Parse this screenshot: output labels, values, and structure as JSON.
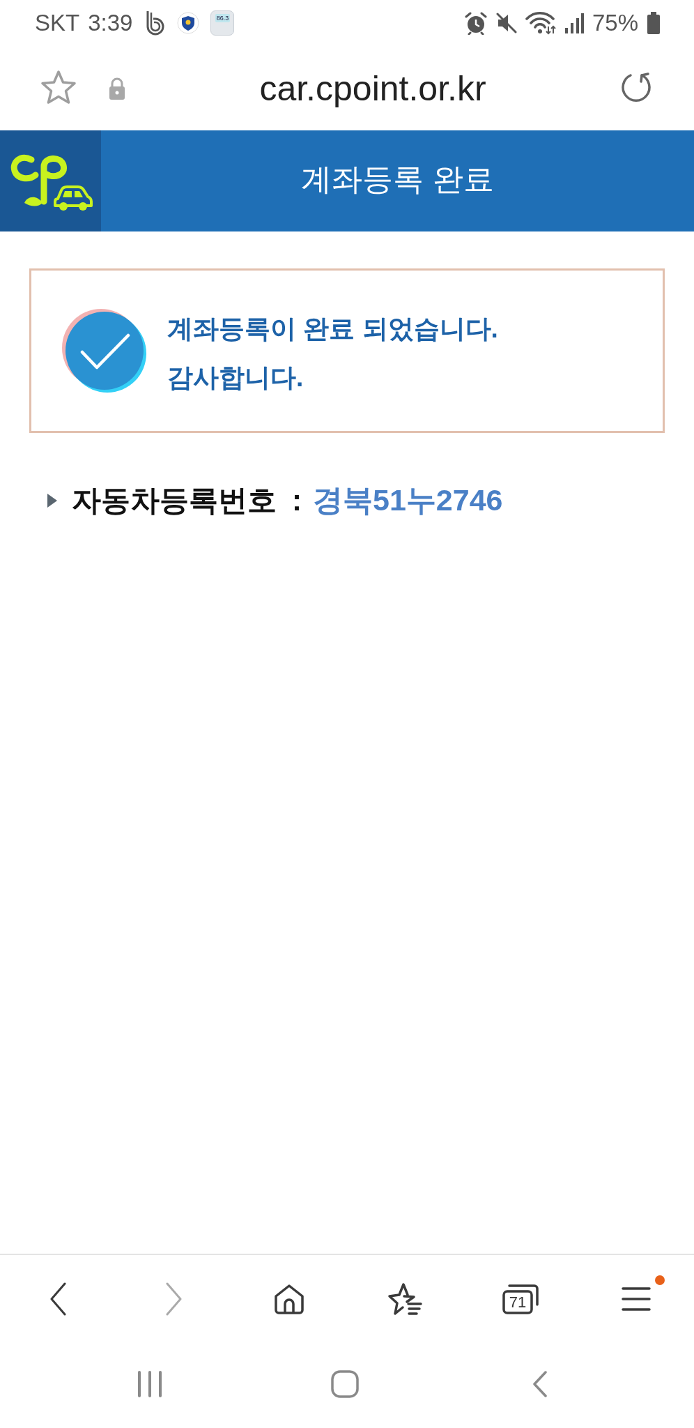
{
  "status_bar": {
    "carrier": "SKT",
    "time": "3:39",
    "meter_reading": "86.3",
    "battery": "75%"
  },
  "address_bar": {
    "url": "car.cpoint.or.kr"
  },
  "header": {
    "title": "계좌등록 완료"
  },
  "message": {
    "lines": [
      "계좌등록이 완료 되었습니다.",
      "감사합니다."
    ]
  },
  "vehicle": {
    "label": "자동차등록번호",
    "separator": ":",
    "value": "경북51누2746"
  },
  "toolbar": [
    {
      "kind": "back",
      "disabled": false,
      "badge": false
    },
    {
      "kind": "forward",
      "disabled": true,
      "badge": false
    },
    {
      "kind": "home",
      "disabled": false,
      "badge": false
    },
    {
      "kind": "bookmarks",
      "disabled": false,
      "badge": false
    },
    {
      "kind": "tabs",
      "label": "71",
      "disabled": false,
      "badge": false
    },
    {
      "kind": "menu",
      "disabled": false,
      "badge": true
    }
  ]
}
